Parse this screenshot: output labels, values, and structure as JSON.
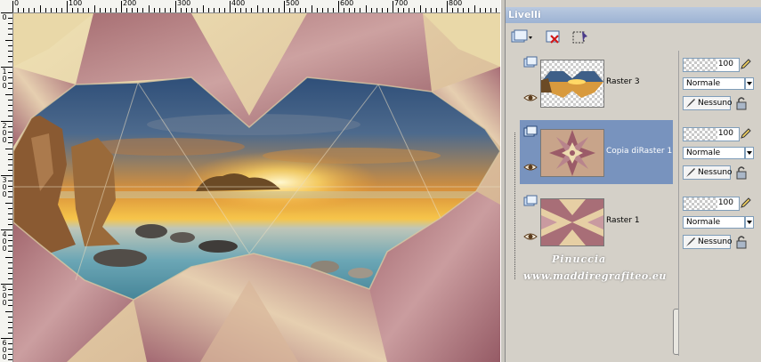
{
  "ruler": {
    "top_labels": [
      "0",
      "100",
      "200",
      "300",
      "400",
      "500",
      "600",
      "700",
      "800"
    ],
    "left_labels": [
      "0",
      "100",
      "200",
      "300",
      "400",
      "500",
      "600"
    ]
  },
  "palette": {
    "title": "Livelli",
    "layers": [
      {
        "name": "Raster 3",
        "opacity": "100",
        "blend": "Normale",
        "mask": "Nessuno",
        "selected": false
      },
      {
        "name": "Copia diRaster 1",
        "opacity": "100",
        "blend": "Normale",
        "mask": "Nessuno",
        "selected": true
      },
      {
        "name": "Raster 1",
        "opacity": "100",
        "blend": "Normale",
        "mask": "Nessuno",
        "selected": false
      }
    ]
  },
  "watermark": {
    "line1": "Pinuccia",
    "line2": "www.maddiregrafiteo.eu"
  },
  "colors": {
    "selection": "#7893be",
    "titlebar": "#9db3d3",
    "mauve": "#a56a74",
    "cream": "#e8d9a6"
  }
}
